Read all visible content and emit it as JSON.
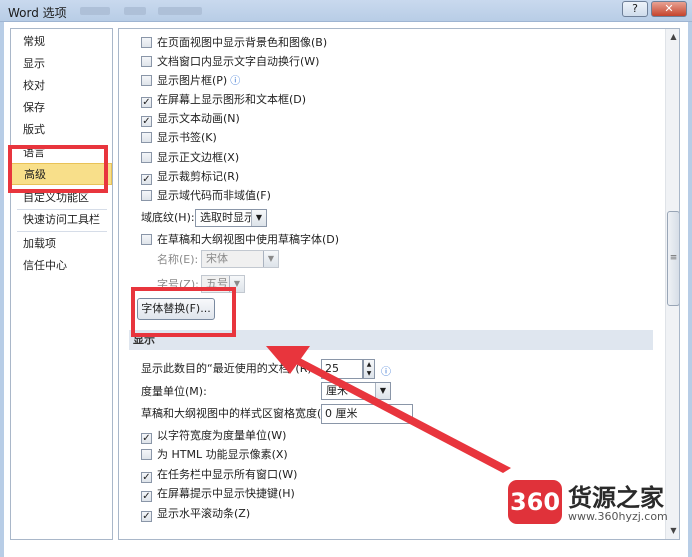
{
  "window": {
    "title": "Word 选项",
    "help_label": "?",
    "close_label": "✕"
  },
  "nav": {
    "items": [
      {
        "label": "常规"
      },
      {
        "label": "显示"
      },
      {
        "label": "校对"
      },
      {
        "label": "保存"
      },
      {
        "label": "版式"
      },
      {
        "label": "语言"
      },
      {
        "label": "高级",
        "selected": true
      },
      {
        "label": "自定义功能区"
      },
      {
        "label": "快速访问工具栏"
      },
      {
        "label": "加载项"
      },
      {
        "label": "信任中心"
      }
    ]
  },
  "display_options": {
    "items": [
      {
        "label": "在页面视图中显示背景色和图像(B)",
        "checked": false
      },
      {
        "label": "文档窗口内显示文字自动换行(W)",
        "checked": false
      },
      {
        "label": "显示图片框(P)",
        "checked": false
      },
      {
        "label": "在屏幕上显示图形和文本框(D)",
        "checked": true
      },
      {
        "label": "显示文本动画(N)",
        "checked": true
      },
      {
        "label": "显示书签(K)",
        "checked": false
      },
      {
        "label": "显示正文边框(X)",
        "checked": false
      },
      {
        "label": "显示裁剪标记(R)",
        "checked": true
      },
      {
        "label": "显示域代码而非域值(F)",
        "checked": false
      }
    ],
    "field_shading_label": "域底纹(H):",
    "field_shading_value": "选取时显示",
    "draft_font_label": "在草稿和大纲视图中使用草稿字体(D)",
    "draft_font_checked": false,
    "font_name_label": "名称(E):",
    "font_name_value": "宋体",
    "font_size_label": "字号(Z):",
    "font_size_value": "五号",
    "font_sub_button": "字体替换(F)..."
  },
  "display_section": {
    "title": "显示",
    "recent_docs_label": "显示此数目的“最近使用的文档”(R):",
    "recent_docs_value": "25",
    "units_label": "度量单位(M):",
    "units_value": "厘米",
    "style_width_label": "草稿和大纲视图中的样式区窗格宽度(E):",
    "style_width_value": "0 厘米",
    "items": [
      {
        "label": "以字符宽度为度量单位(W)",
        "checked": true
      },
      {
        "label": "为 HTML 功能显示像素(X)",
        "checked": false
      },
      {
        "label": "在任务栏中显示所有窗口(W)",
        "checked": true
      },
      {
        "label": "在屏幕提示中显示快捷键(H)",
        "checked": true
      },
      {
        "label": "显示水平滚动条(Z)",
        "checked": true
      }
    ]
  },
  "icons": {
    "info": "ⓘ",
    "dropdown": "▼",
    "spin_up": "▲",
    "spin_down": "▼",
    "check": "✓",
    "scroll_grip": "≡"
  },
  "watermark": {
    "badge": "360",
    "name": "货源之家",
    "url": "www.360hyzj.com"
  },
  "annotation_color": "#e8353d",
  "selection_color": "#f8df8a"
}
